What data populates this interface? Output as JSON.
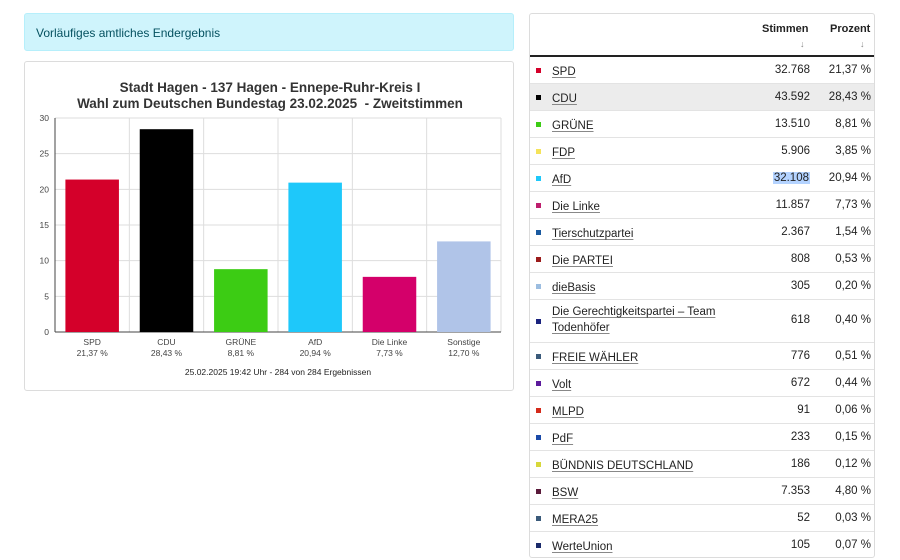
{
  "status": {
    "text": "Vorläufiges amtliches Endergebnis"
  },
  "chart_data": {
    "type": "bar",
    "title": "Stadt Hagen - 137 Hagen - Ennepe-Ruhr-Kreis I",
    "subtitle": "Wahl zum Deutschen Bundestag 23.02.2025  - Zweitstimmen",
    "categories": [
      "SPD",
      "CDU",
      "GRÜNE",
      "AfD",
      "Die Linke",
      "Sonstige"
    ],
    "category_pct_labels": [
      "21,37 %",
      "28,43 %",
      "8,81 %",
      "20,94 %",
      "7,73 %",
      "12,70 %"
    ],
    "values": [
      21.37,
      28.43,
      8.81,
      20.94,
      7.73,
      12.7
    ],
    "colors": [
      "#d4002a",
      "#000000",
      "#3ccc14",
      "#1ec8fa",
      "#d4006a",
      "#b0c4e8"
    ],
    "ylim": [
      0,
      30
    ],
    "yticks": [
      0,
      5,
      10,
      15,
      20,
      25,
      30
    ],
    "grid": true,
    "footer": "25.02.2025 19:42 Uhr - 284 von 284 Ergebnissen"
  },
  "table": {
    "col_votes": "Stimmen",
    "col_pct": "Prozent",
    "sort_icon": "↓",
    "rows": [
      {
        "party": "SPD",
        "votes": "32.768",
        "pct": "21,37 %",
        "color": "#d4002a"
      },
      {
        "party": "CDU",
        "votes": "43.592",
        "pct": "28,43 %",
        "color": "#000000"
      },
      {
        "party": "GRÜNE",
        "votes": "13.510",
        "pct": "8,81 %",
        "color": "#3ccc14"
      },
      {
        "party": "FDP",
        "votes": "5.906",
        "pct": "3,85 %",
        "color": "#f5e35a"
      },
      {
        "party": "AfD",
        "votes": "32.108",
        "pct": "20,94 %",
        "color": "#1ec8fa"
      },
      {
        "party": "Die Linke",
        "votes": "11.857",
        "pct": "7,73 %",
        "color": "#be1e6e"
      },
      {
        "party": "Tierschutzpartei",
        "votes": "2.367",
        "pct": "1,54 %",
        "color": "#1a5aa0"
      },
      {
        "party": "Die PARTEI",
        "votes": "808",
        "pct": "0,53 %",
        "color": "#9b1b1b"
      },
      {
        "party": "dieBasis",
        "votes": "305",
        "pct": "0,20 %",
        "color": "#9cbde0"
      },
      {
        "party": "Die Gerechtigkeitspartei – Team Todenhöfer",
        "votes": "618",
        "pct": "0,40 %",
        "color": "#1a237e"
      },
      {
        "party": "FREIE WÄHLER",
        "votes": "776",
        "pct": "0,51 %",
        "color": "#3a5a7a"
      },
      {
        "party": "Volt",
        "votes": "672",
        "pct": "0,44 %",
        "color": "#5c1a9c"
      },
      {
        "party": "MLPD",
        "votes": "91",
        "pct": "0,06 %",
        "color": "#d42a1a"
      },
      {
        "party": "PdF",
        "votes": "233",
        "pct": "0,15 %",
        "color": "#1a4aa8"
      },
      {
        "party": "BÜNDNIS DEUTSCHLAND",
        "votes": "186",
        "pct": "0,12 %",
        "color": "#d8d83a"
      },
      {
        "party": "BSW",
        "votes": "7.353",
        "pct": "4,80 %",
        "color": "#5a1a3a"
      },
      {
        "party": "MERA25",
        "votes": "52",
        "pct": "0,03 %",
        "color": "#3a5a7a"
      },
      {
        "party": "WerteUnion",
        "votes": "105",
        "pct": "0,07 %",
        "color": "#1a2a6a"
      }
    ]
  }
}
